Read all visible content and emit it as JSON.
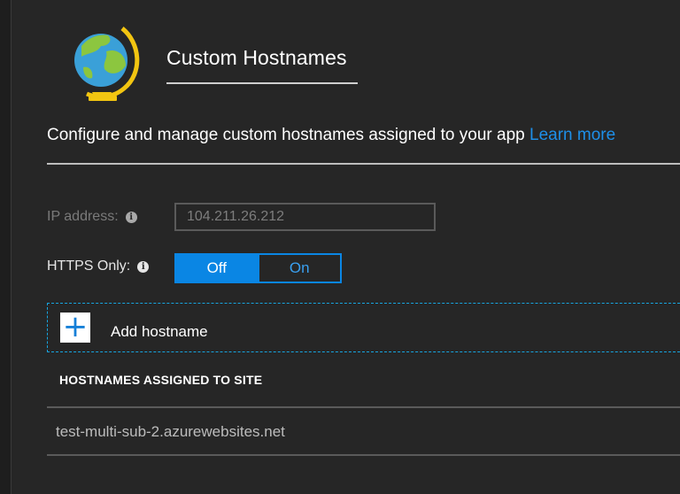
{
  "header": {
    "title": "Custom Hostnames",
    "icon": "globe-icon"
  },
  "description": {
    "text": "Configure and manage custom hostnames assigned to your app ",
    "link_label": "Learn more"
  },
  "fields": {
    "ip_address": {
      "label": "IP address:",
      "value": "104.211.26.212"
    },
    "https_only": {
      "label": "HTTPS Only:",
      "options": [
        "Off",
        "On"
      ],
      "selected": "Off"
    }
  },
  "add_hostname": {
    "label": "Add hostname",
    "icon": "plus-icon"
  },
  "table": {
    "header": "HOSTNAMES ASSIGNED TO SITE",
    "rows": [
      "test-multi-sub-2.azurewebsites.net"
    ]
  },
  "colors": {
    "accent": "#0a86e4",
    "link": "#1e8fe8",
    "background": "#262626"
  }
}
